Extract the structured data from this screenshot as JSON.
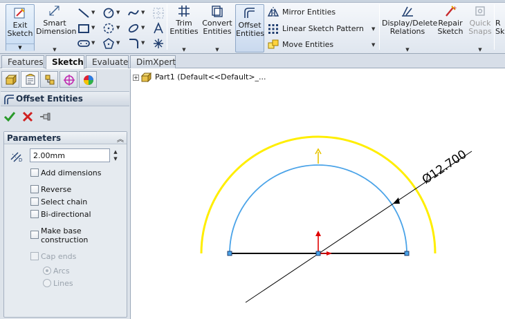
{
  "ribbon": {
    "exit_sketch": "Exit\nSketch",
    "smart_dimension": "Smart\nDimension",
    "trim_entities": "Trim\nEntities",
    "convert_entities": "Convert\nEntities",
    "offset_entities": "Offset\nEntities",
    "mirror_entities": "Mirror Entities",
    "linear_sketch_pattern": "Linear Sketch Pattern",
    "move_entities": "Move Entities",
    "display_delete_relations": "Display/Delete\nRelations",
    "repair_sketch": "Repair\nSketch",
    "quick_snaps": "Quick\nSnaps",
    "cut_label": "R\nSk"
  },
  "tabs": [
    "Features",
    "Sketch",
    "Evaluate",
    "DimXpert"
  ],
  "active_tab": "Sketch",
  "property_manager": {
    "title": "Offset Entities",
    "params_title": "Parameters",
    "distance_value": "2.00mm",
    "checkboxes": [
      {
        "label": "Add dimensions",
        "checked": false,
        "enabled": true
      },
      {
        "label": "Reverse",
        "checked": false,
        "enabled": true
      },
      {
        "label": "Select chain",
        "checked": false,
        "enabled": true
      },
      {
        "label": "Bi-directional",
        "checked": false,
        "enabled": true
      },
      {
        "label": "Make base\nconstruction",
        "checked": false,
        "enabled": true
      },
      {
        "label": "Cap ends",
        "checked": false,
        "enabled": false
      }
    ],
    "cap_options": [
      {
        "label": "Arcs",
        "selected": true
      },
      {
        "label": "Lines",
        "selected": false
      }
    ]
  },
  "tree": {
    "part_label": "Part1  (Default<<Default>_..."
  },
  "sketch": {
    "dimension_text": "Ø12.700",
    "colors": {
      "offset_arc": "#ffee00",
      "base_arc": "#4aa3e8",
      "line": "#000000",
      "origin_y": "#e00000",
      "origin_x": "#e00000"
    }
  }
}
